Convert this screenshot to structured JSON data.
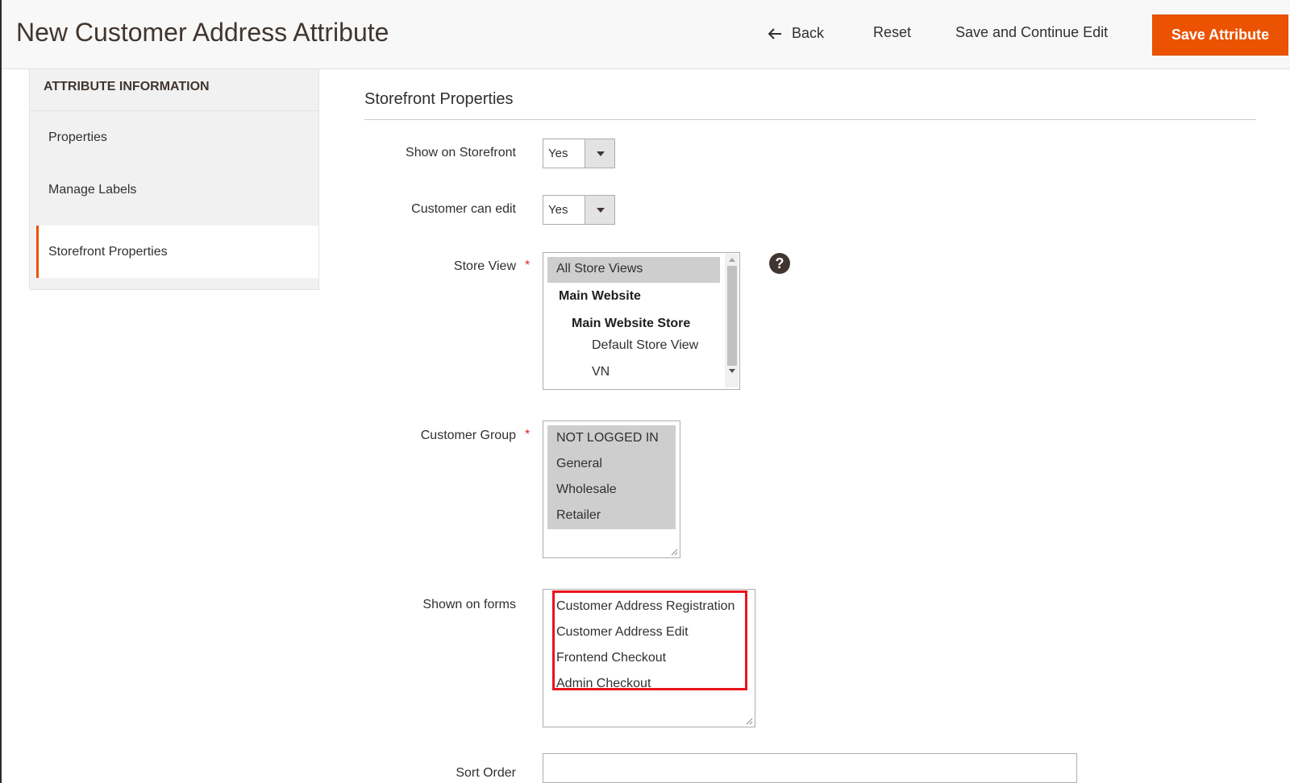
{
  "header": {
    "title": "New Customer Address Attribute",
    "back_label": "Back",
    "reset_label": "Reset",
    "save_continue_label": "Save and Continue Edit",
    "save_label": "Save Attribute"
  },
  "sidebar": {
    "heading": "ATTRIBUTE INFORMATION",
    "items": [
      {
        "label": "Properties"
      },
      {
        "label": "Manage Labels"
      },
      {
        "label": "Storefront Properties",
        "active": true
      }
    ]
  },
  "section": {
    "title": "Storefront Properties"
  },
  "fields": {
    "show_on_storefront": {
      "label": "Show on Storefront",
      "value": "Yes"
    },
    "customer_can_edit": {
      "label": "Customer can edit",
      "value": "Yes"
    },
    "store_view": {
      "label": "Store View",
      "required_mark": "*",
      "options": [
        "All Store Views",
        "Main Website",
        "Main Website Store",
        "Default Store View",
        "VN"
      ],
      "selected": [
        "All Store Views"
      ]
    },
    "customer_group": {
      "label": "Customer Group",
      "required_mark": "*",
      "options": [
        "NOT LOGGED IN",
        "General",
        "Wholesale",
        "Retailer"
      ],
      "selected": [
        "NOT LOGGED IN",
        "General",
        "Wholesale",
        "Retailer"
      ]
    },
    "shown_on_forms": {
      "label": "Shown on forms",
      "options": [
        "Customer Address Registration",
        "Customer Address Edit",
        "Frontend Checkout",
        "Admin Checkout"
      ]
    },
    "sort_order": {
      "label": "Sort Order",
      "value": ""
    }
  },
  "help_icon_glyph": "?",
  "colors": {
    "accent": "#eb5202",
    "highlight_box": "#e8141c",
    "selected_option_bg": "#cecece"
  }
}
